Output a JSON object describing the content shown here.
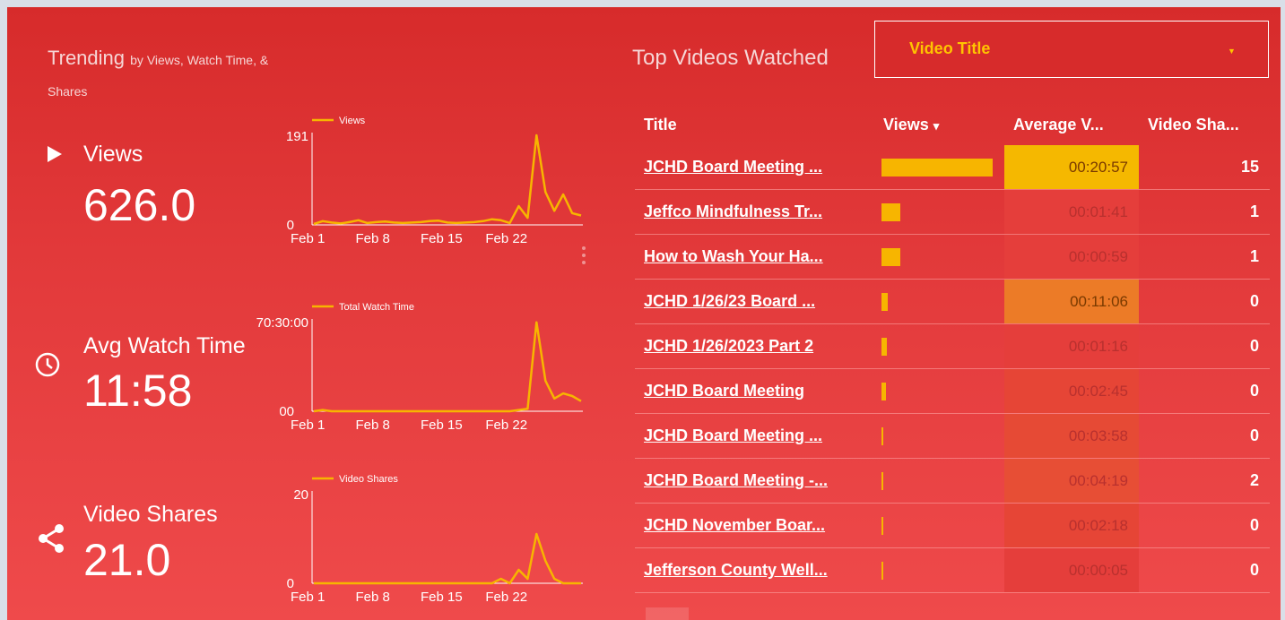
{
  "trending": {
    "title": "Trending",
    "subtitle_line1": "by Views, Watch Time, &",
    "subtitle_line2": "Shares"
  },
  "kpis": [
    {
      "label": "Views",
      "value": "626.0",
      "icon": "play-icon"
    },
    {
      "label": "Avg Watch Time",
      "value": "11:58",
      "icon": "clock-icon"
    },
    {
      "label": "Video Shares",
      "value": "21.0",
      "icon": "share-icon"
    }
  ],
  "chart_data": [
    {
      "type": "line",
      "legend": [
        "Views"
      ],
      "yticks": [
        "191",
        "0"
      ],
      "xticks": [
        "Feb 1",
        "Feb 8",
        "Feb 15",
        "Feb 22"
      ],
      "ylim": [
        0,
        191
      ],
      "series": [
        {
          "name": "Views",
          "values": [
            2,
            8,
            5,
            3,
            6,
            10,
            4,
            6,
            7,
            5,
            4,
            5,
            6,
            8,
            9,
            5,
            4,
            5,
            6,
            8,
            12,
            10,
            4,
            40,
            15,
            191,
            70,
            30,
            65,
            25,
            20
          ]
        }
      ]
    },
    {
      "type": "line",
      "legend": [
        "Total Watch Time"
      ],
      "yticks": [
        "70:30:00",
        "00"
      ],
      "xticks": [
        "Feb 1",
        "Feb 8",
        "Feb 15",
        "Feb 22"
      ],
      "ylim": [
        0,
        70.5
      ],
      "series": [
        {
          "name": "Total Watch Time",
          "values": [
            0,
            1,
            0,
            0,
            0,
            0,
            0,
            0,
            0,
            0,
            0,
            0,
            0,
            0,
            0,
            0,
            0,
            0,
            0,
            0,
            0,
            0,
            0,
            1,
            2,
            70,
            24,
            10,
            14,
            12,
            8
          ]
        }
      ]
    },
    {
      "type": "line",
      "legend": [
        "Video Shares"
      ],
      "yticks": [
        "20",
        "0"
      ],
      "xticks": [
        "Feb 1",
        "Feb 8",
        "Feb 15",
        "Feb 22"
      ],
      "ylim": [
        0,
        20
      ],
      "series": [
        {
          "name": "Video Shares",
          "values": [
            0,
            0,
            0,
            0,
            0,
            0,
            0,
            0,
            0,
            0,
            0,
            0,
            0,
            0,
            0,
            0,
            0,
            0,
            0,
            0,
            0,
            1,
            0,
            3,
            1,
            11,
            5,
            1,
            0,
            0,
            0
          ]
        }
      ]
    }
  ],
  "top_videos": {
    "title": "Top Videos Watched",
    "dropdown_value": "Video Title",
    "columns": [
      "Title",
      "Views",
      "Average V...",
      "Video Sha..."
    ],
    "sort_indicator": "▾",
    "rows": [
      {
        "title": "JCHD Board Meeting ...",
        "views_fraction": 1.0,
        "avg": "00:20:57",
        "avg_color": "#f5b800",
        "shares": "15"
      },
      {
        "title": "Jeffco Mindfulness Tr...",
        "views_fraction": 0.17,
        "avg": "00:01:41",
        "avg_color": "#e53e3b",
        "shares": "1"
      },
      {
        "title": "How to Wash Your Ha...",
        "views_fraction": 0.17,
        "avg": "00:00:59",
        "avg_color": "#e53e3b",
        "shares": "1"
      },
      {
        "title": "JCHD 1/26/23 Board ...",
        "views_fraction": 0.06,
        "avg": "00:11:06",
        "avg_color": "#ec7b27",
        "shares": "0"
      },
      {
        "title": "JCHD 1/26/2023 Part 2",
        "views_fraction": 0.05,
        "avg": "00:01:16",
        "avg_color": "#e53e3b",
        "shares": "0"
      },
      {
        "title": "JCHD Board Meeting",
        "views_fraction": 0.04,
        "avg": "00:02:45",
        "avg_color": "#e64536",
        "shares": "0"
      },
      {
        "title": "JCHD Board Meeting ...",
        "views_fraction": 0.015,
        "avg": "00:03:58",
        "avg_color": "#e64a35",
        "shares": "0"
      },
      {
        "title": "JCHD Board Meeting -...",
        "views_fraction": 0.015,
        "avg": "00:04:19",
        "avg_color": "#e74e35",
        "shares": "2"
      },
      {
        "title": "JCHD November Boar...",
        "views_fraction": 0.015,
        "avg": "00:02:18",
        "avg_color": "#e64536",
        "shares": "0"
      },
      {
        "title": "Jefferson County Well...",
        "views_fraction": 0.015,
        "avg": "00:00:05",
        "avg_color": "#e53e3b",
        "shares": "0"
      }
    ]
  },
  "colors": {
    "accent": "#f7b500",
    "panel": "#d72b2b"
  }
}
